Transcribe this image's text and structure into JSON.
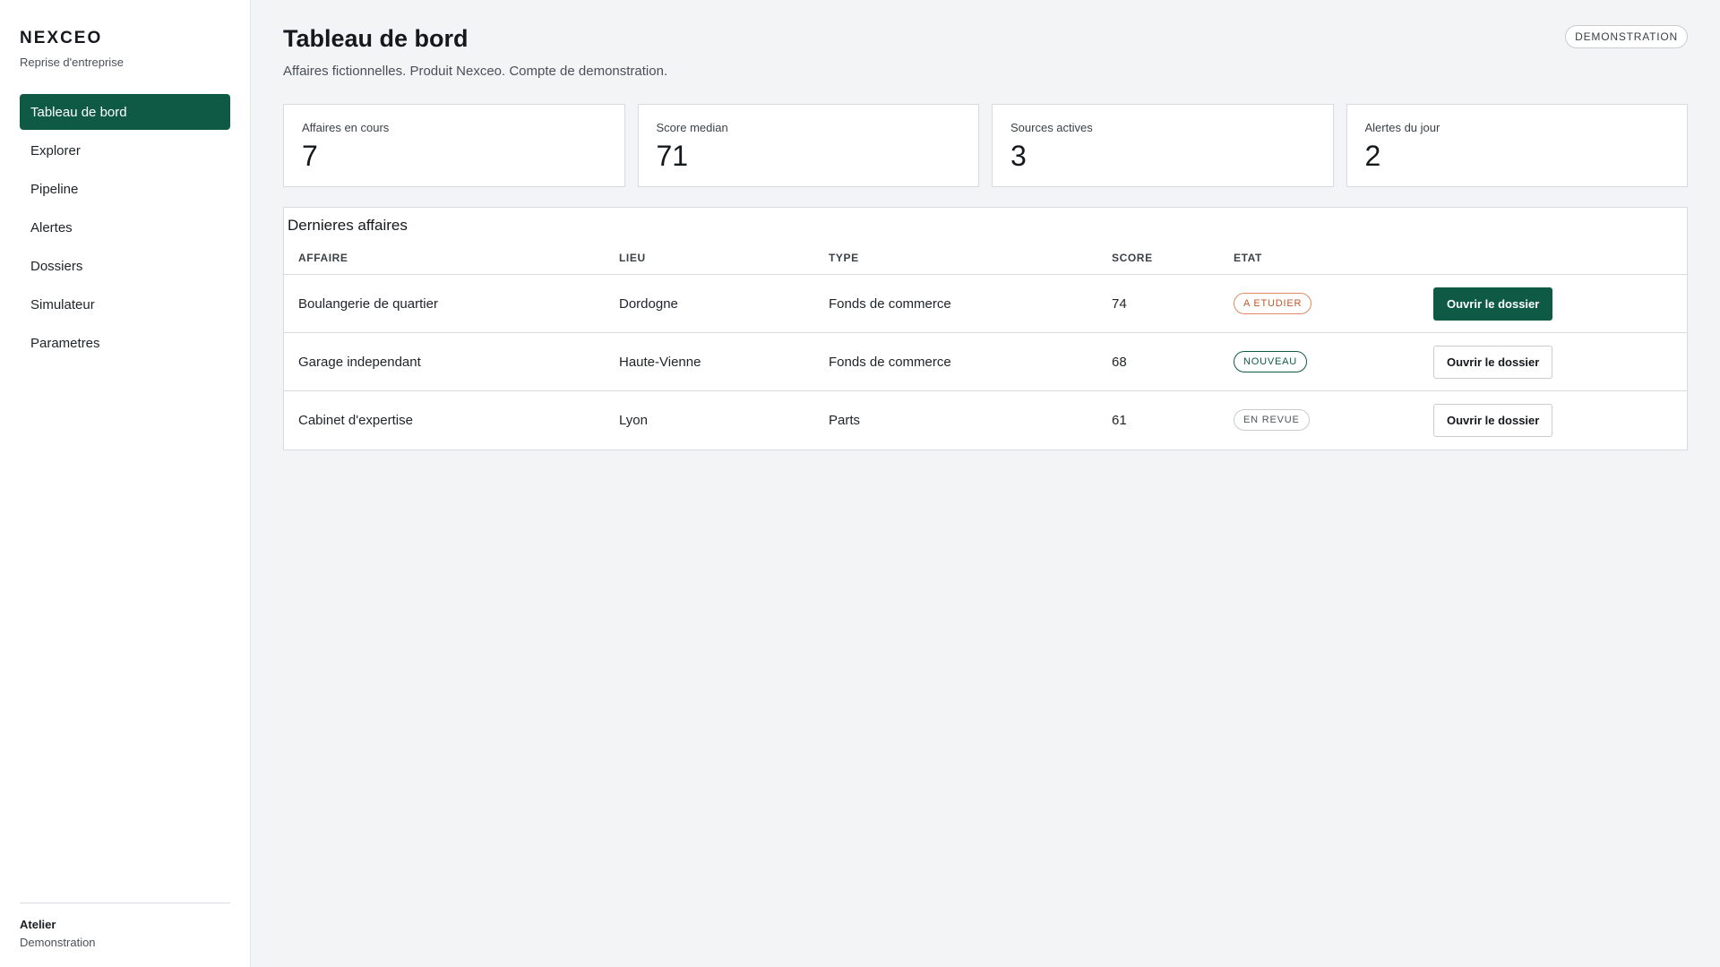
{
  "brand": {
    "name": "NEXCEO",
    "subtitle": "Reprise d'entreprise"
  },
  "nav": {
    "items": [
      {
        "label": "Tableau de bord",
        "active": true
      },
      {
        "label": "Explorer",
        "active": false
      },
      {
        "label": "Pipeline",
        "active": false
      },
      {
        "label": "Alertes",
        "active": false
      },
      {
        "label": "Dossiers",
        "active": false
      },
      {
        "label": "Simulateur",
        "active": false
      },
      {
        "label": "Parametres",
        "active": false
      }
    ]
  },
  "sidebar_footer": {
    "title": "Atelier",
    "subtitle": "Demonstration"
  },
  "header": {
    "title": "Tableau de bord",
    "subtitle": "Affaires fictionnelles. Produit Nexceo. Compte de demonstration.",
    "badge": "DEMONSTRATION"
  },
  "stats": [
    {
      "label": "Affaires en cours",
      "value": "7"
    },
    {
      "label": "Score median",
      "value": "71"
    },
    {
      "label": "Sources actives",
      "value": "3"
    },
    {
      "label": "Alertes du jour",
      "value": "2"
    }
  ],
  "deals": {
    "title": "Dernieres affaires",
    "columns": {
      "affaire": "AFFAIRE",
      "lieu": "LIEU",
      "type": "TYPE",
      "score": "SCORE",
      "etat": "ETAT"
    },
    "rows": [
      {
        "affaire": "Boulangerie de quartier",
        "lieu": "Dordogne",
        "type": "Fonds de commerce",
        "score": "74",
        "etat": "A ETUDIER",
        "etat_tone": "orange",
        "action": "Ouvrir le dossier",
        "primary": true
      },
      {
        "affaire": "Garage independant",
        "lieu": "Haute-Vienne",
        "type": "Fonds de commerce",
        "score": "68",
        "etat": "NOUVEAU",
        "etat_tone": "green",
        "action": "Ouvrir le dossier",
        "primary": false
      },
      {
        "affaire": "Cabinet d'expertise",
        "lieu": "Lyon",
        "type": "Parts",
        "score": "61",
        "etat": "EN REVUE",
        "etat_tone": "grey",
        "action": "Ouvrir le dossier",
        "primary": false
      }
    ]
  },
  "colors": {
    "accent": "#0e5a45",
    "status_orange": "#c2562a",
    "status_green": "#0e5a45",
    "status_grey": "#50555c",
    "background": "#f3f4f6"
  }
}
